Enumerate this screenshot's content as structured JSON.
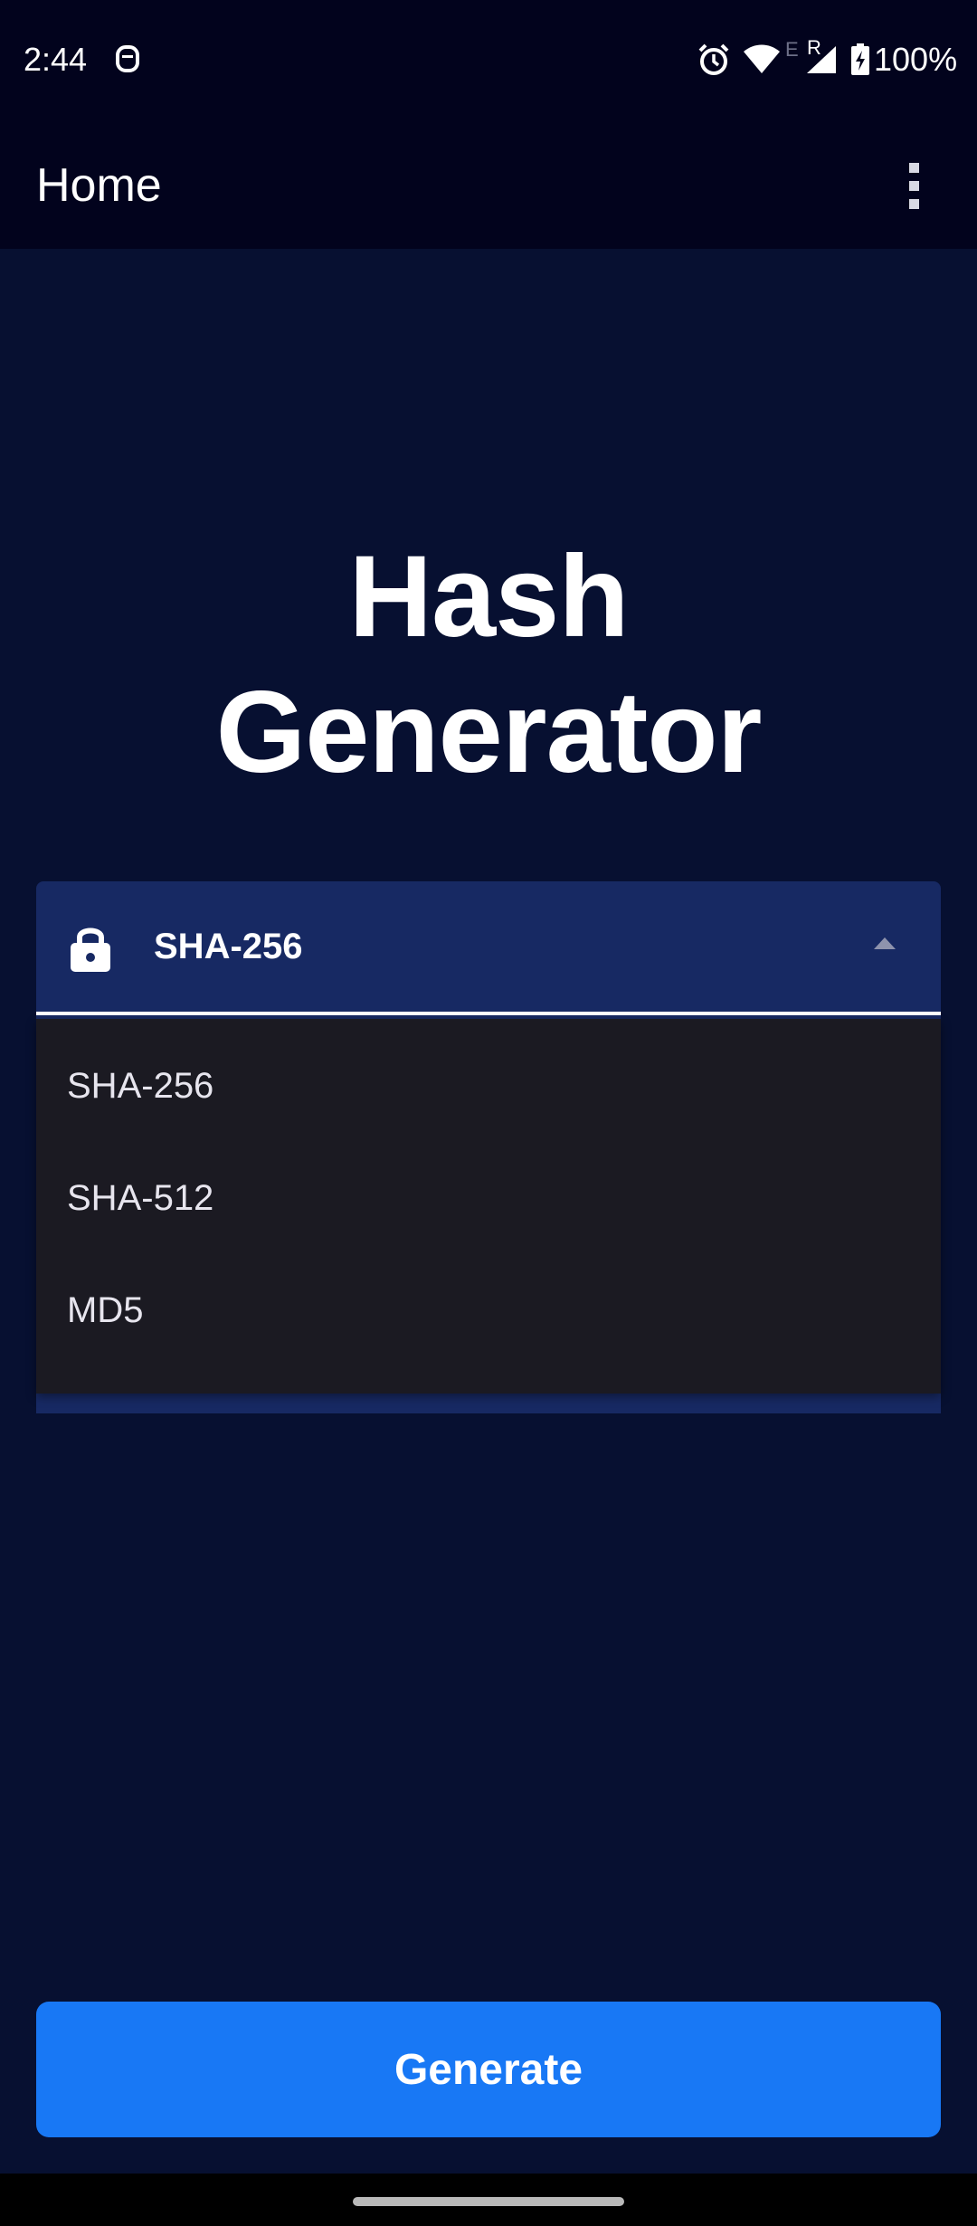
{
  "status_bar": {
    "time": "2:44",
    "network_label": "E",
    "roaming_label": "R",
    "battery": "100%",
    "icons": [
      "assistant-icon",
      "alarm-icon",
      "wifi-icon",
      "signal-icon",
      "battery-charging-icon"
    ]
  },
  "app_bar": {
    "title": "Home",
    "menu_icon": "more-vertical-icon"
  },
  "main": {
    "heading_line1": "Hash",
    "heading_line2": "Generator"
  },
  "hash_select": {
    "icon": "lock-icon",
    "selected": "SHA-256",
    "expanded": true,
    "options": [
      "SHA-256",
      "SHA-512",
      "MD5"
    ]
  },
  "actions": {
    "generate_label": "Generate"
  },
  "colors": {
    "background": "#071031",
    "app_bar": "#02031d",
    "field": "#172963",
    "menu": "#1b1a22",
    "accent": "#1878f5"
  }
}
